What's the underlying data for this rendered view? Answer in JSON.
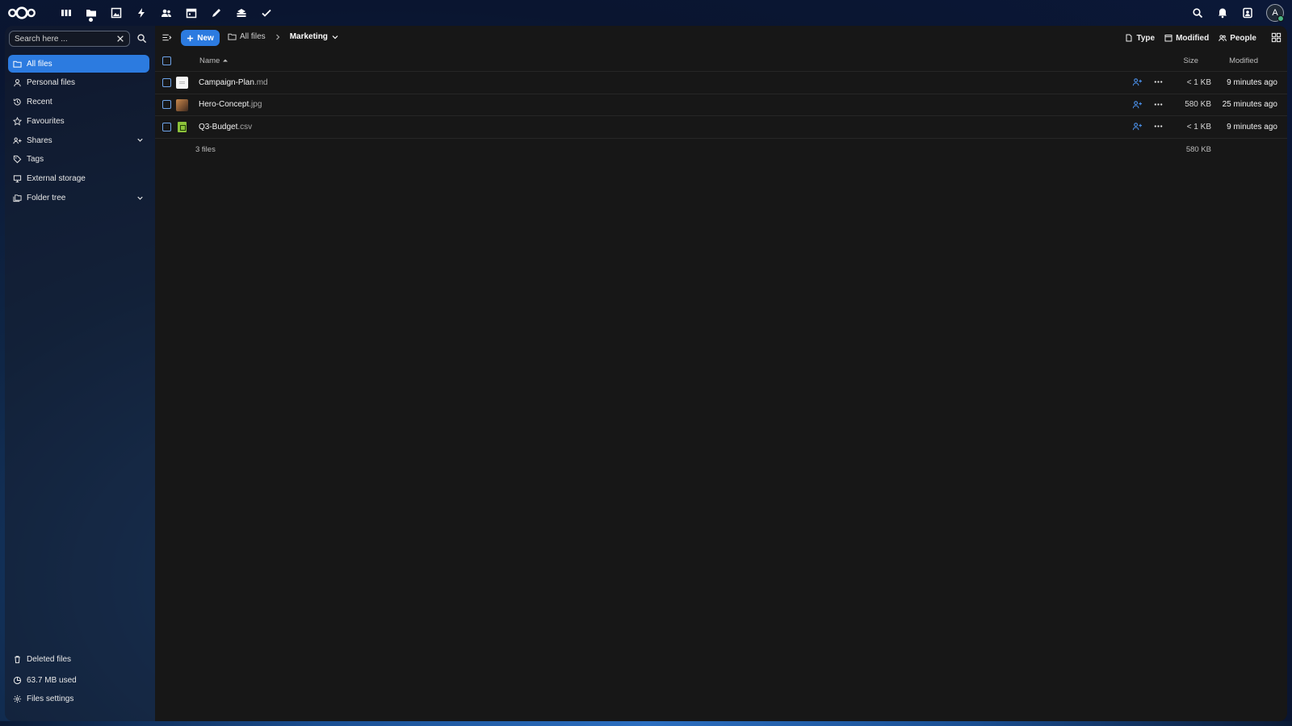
{
  "topbar": {
    "logo": "nextcloud-logo",
    "apps": [
      {
        "name": "dashboard",
        "icon": "dashboard-icon",
        "active": false
      },
      {
        "name": "files",
        "icon": "folder-icon",
        "active": true
      },
      {
        "name": "photos",
        "icon": "image-icon",
        "active": false
      },
      {
        "name": "activity",
        "icon": "lightning-icon",
        "active": false
      },
      {
        "name": "contacts",
        "icon": "contacts-icon",
        "active": false
      },
      {
        "name": "calendar",
        "icon": "calendar-icon",
        "active": false
      },
      {
        "name": "notes",
        "icon": "pencil-icon",
        "active": false
      },
      {
        "name": "deck",
        "icon": "stack-icon",
        "active": false
      },
      {
        "name": "tasks",
        "icon": "check-icon",
        "active": false
      }
    ],
    "right_icons": [
      "search-icon",
      "bell-icon",
      "contacts-menu-icon"
    ],
    "avatar_initial": "A"
  },
  "sidebar": {
    "search_placeholder": "Search here ...",
    "items": [
      {
        "label": "All files",
        "icon": "folder-icon",
        "active": true
      },
      {
        "label": "Personal files",
        "icon": "person-icon",
        "active": false
      },
      {
        "label": "Recent",
        "icon": "history-icon",
        "active": false
      },
      {
        "label": "Favourites",
        "icon": "star-icon",
        "active": false
      },
      {
        "label": "Shares",
        "icon": "share-icon",
        "active": false,
        "expandable": true
      },
      {
        "label": "Tags",
        "icon": "tag-icon",
        "active": false
      },
      {
        "label": "External storage",
        "icon": "monitor-icon",
        "active": false
      },
      {
        "label": "Folder tree",
        "icon": "folder-multiple-icon",
        "active": false,
        "expandable": true
      }
    ],
    "bottom": {
      "deleted": "Deleted files",
      "quota": "63.7 MB used",
      "settings": "Files settings"
    }
  },
  "toolbar": {
    "new_label": "New",
    "breadcrumb_root": "All files",
    "breadcrumb_current": "Marketing",
    "filters": {
      "type": "Type",
      "modified": "Modified",
      "people": "People"
    }
  },
  "table": {
    "headers": {
      "name": "Name",
      "size": "Size",
      "modified": "Modified"
    },
    "rows": [
      {
        "base": "Campaign-Plan",
        "ext": ".md",
        "type": "md",
        "size": "< 1 KB",
        "modified": "9 minutes ago"
      },
      {
        "base": "Hero-Concept",
        "ext": ".jpg",
        "type": "jpg",
        "size": "580 KB",
        "modified": "25 minutes ago"
      },
      {
        "base": "Q3-Budget",
        "ext": ".csv",
        "type": "csv",
        "size": "< 1 KB",
        "modified": "9 minutes ago"
      }
    ],
    "summary": {
      "count": "3 files",
      "total": "580 KB"
    }
  },
  "colors": {
    "accent": "#2c7be0",
    "share": "#4a8fe8",
    "background": "#171717"
  }
}
